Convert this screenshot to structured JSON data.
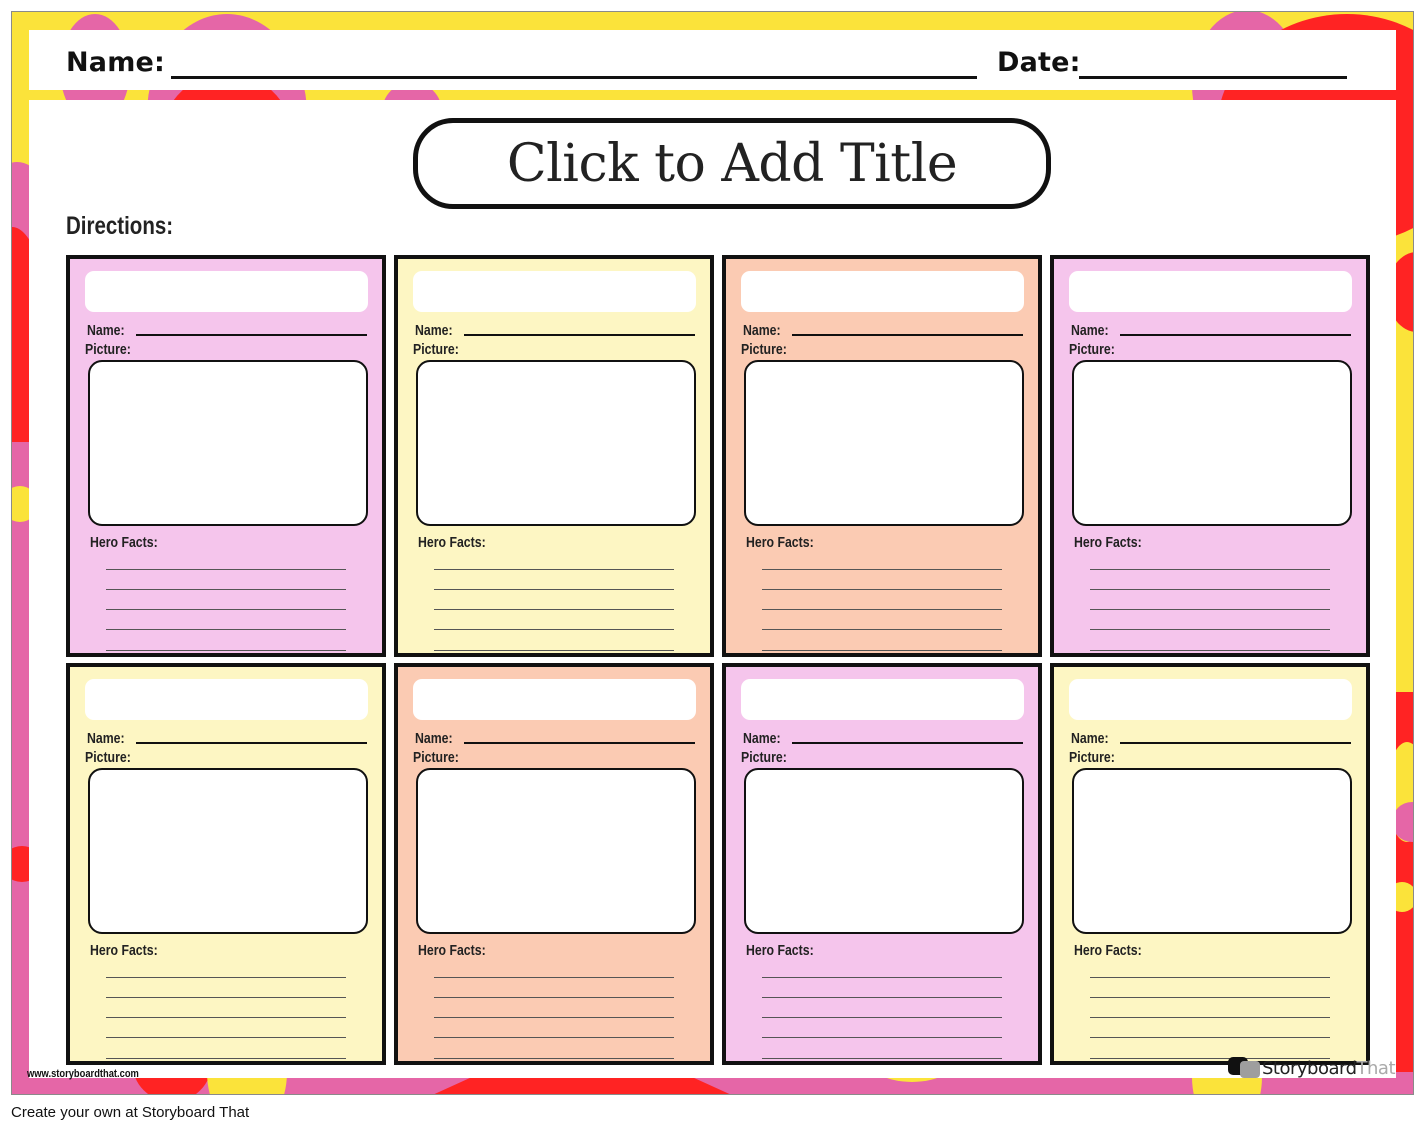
{
  "header": {
    "name_label": "Name:",
    "date_label": "Date:"
  },
  "title": {
    "text": "Click to Add Title"
  },
  "directions_label": "Directions:",
  "card_labels": {
    "name": "Name:",
    "picture": "Picture:",
    "facts": "Hero Facts:"
  },
  "cards": [
    {
      "color": "pink"
    },
    {
      "color": "yellow"
    },
    {
      "color": "peach"
    },
    {
      "color": "pink"
    },
    {
      "color": "yellow"
    },
    {
      "color": "peach"
    },
    {
      "color": "pink"
    },
    {
      "color": "yellow"
    }
  ],
  "fact_lines_per_card": 5,
  "colors": {
    "pink_card": "#f5c5ec",
    "yellow_card": "#fdf6c3",
    "peach_card": "#fbcbb3",
    "frame_yellow": "#fbe33a",
    "frame_pink": "#e566a7",
    "frame_red": "#ff2323"
  },
  "watermark": {
    "url": "www.storyboardthat.com",
    "brand_part1": "Storyboard",
    "brand_part2": "That"
  },
  "footer": {
    "text": "Create your own at Storyboard That"
  }
}
